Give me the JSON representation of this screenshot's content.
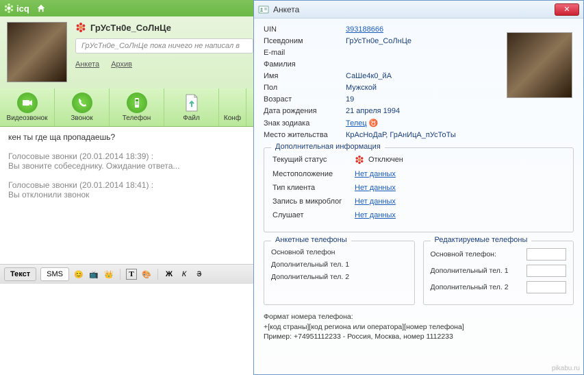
{
  "header": {
    "brand": "icq"
  },
  "user": {
    "name": "ГрУсТн0е_СоЛнЦе",
    "status_placeholder": "ГрУсТн0е_СоЛнЦе пока ничего не написал в",
    "link_profile": "Анкета",
    "link_archive": "Архив"
  },
  "toolbar": {
    "video": "Видеозвонок",
    "call": "Звонок",
    "phone": "Телефон",
    "file": "Файл",
    "conf": "Конф"
  },
  "chat": {
    "line1": "кен ты где ща пропадаешь?",
    "sys1_title": "Голосовые звонки (20.01.2014 18:39) :",
    "sys1_body": "Вы звоните собеседнику. Ожидание ответа...",
    "sys2_title": "Голосовые звонки (20.01.2014 18:41) :",
    "sys2_body": "Вы отклонили звонок"
  },
  "bottom": {
    "tab_text": "Текст",
    "tab_sms": "SMS",
    "bold": "Ж",
    "italic": "К",
    "strike": "З"
  },
  "profile": {
    "title": "Анкета",
    "labels": {
      "uin": "UIN",
      "nickname": "Псевдоним",
      "email": "E-mail",
      "lastname": "Фамилия",
      "firstname": "Имя",
      "gender": "Пол",
      "age": "Возраст",
      "birthdate": "Дата рождения",
      "zodiac": "Знак зодиака",
      "location": "Место жительства"
    },
    "values": {
      "uin": "393188666",
      "nickname": "ГрУсТн0е_СоЛнЦе",
      "email": "",
      "lastname": "",
      "firstname": "СаШе4к0_йА",
      "gender": "Мужской",
      "age": "19",
      "birthdate": "21 апреля 1994",
      "zodiac": "Телец",
      "location": "КрАсНоДаР, ГрАнИцА_пУсТоТы"
    },
    "extra": {
      "legend": "Дополнительная информация",
      "status_label": "Текущий статус",
      "status_value": "Отключен",
      "loc_label": "Местоположение",
      "client_label": "Тип клиента",
      "microblog_label": "Запись в микроблог",
      "listening_label": "Слушает",
      "nodata": "Нет данных"
    },
    "phones": {
      "left_legend": "Анкетные телефоны",
      "right_legend": "Редактируемые телефоны",
      "main": "Основной телефон",
      "main_colon": "Основной телефон:",
      "add1": "Дополнительный тел. 1",
      "add2": "Дополнительный тел. 2"
    },
    "footer": {
      "l1": "Формат номера телефона:",
      "l2": "+[код страны][код региона или оператора][номер телефона]",
      "l3": "Пример: +74951112233 - Россия, Москва, номер 1112233"
    }
  },
  "watermark": "pikabu.ru"
}
